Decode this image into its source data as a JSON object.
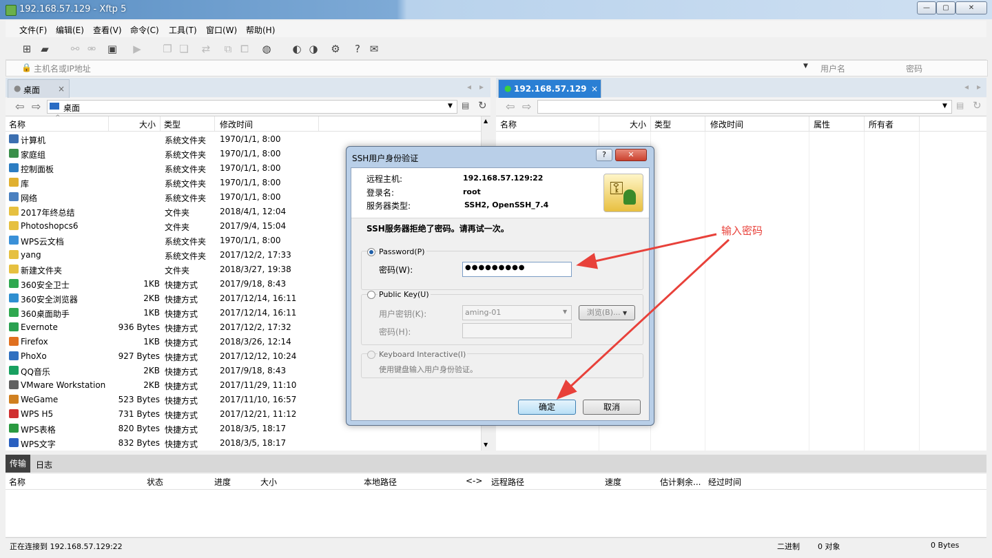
{
  "window": {
    "title": "192.168.57.129 - Xftp 5"
  },
  "menu": [
    "文件(F)",
    "编辑(E)",
    "查看(V)",
    "命令(C)",
    "工具(T)",
    "窗口(W)",
    "帮助(H)"
  ],
  "address": {
    "host_placeholder": "主机名或IP地址",
    "user_placeholder": "用户名",
    "pass_placeholder": "密码"
  },
  "left_pane": {
    "tab": "桌面",
    "path": "桌面",
    "columns": [
      "名称",
      "大小",
      "类型",
      "修改时间"
    ],
    "rows": [
      {
        "name": "计算机",
        "size": "",
        "type": "系统文件夹",
        "mtime": "1970/1/1, 8:00"
      },
      {
        "name": "家庭组",
        "size": "",
        "type": "系统文件夹",
        "mtime": "1970/1/1, 8:00"
      },
      {
        "name": "控制面板",
        "size": "",
        "type": "系统文件夹",
        "mtime": "1970/1/1, 8:00"
      },
      {
        "name": "库",
        "size": "",
        "type": "系统文件夹",
        "mtime": "1970/1/1, 8:00"
      },
      {
        "name": "网络",
        "size": "",
        "type": "系统文件夹",
        "mtime": "1970/1/1, 8:00"
      },
      {
        "name": "2017年终总结",
        "size": "",
        "type": "文件夹",
        "mtime": "2018/4/1, 12:04"
      },
      {
        "name": "Photoshopcs6",
        "size": "",
        "type": "文件夹",
        "mtime": "2017/9/4, 15:04"
      },
      {
        "name": "WPS云文档",
        "size": "",
        "type": "系统文件夹",
        "mtime": "1970/1/1, 8:00"
      },
      {
        "name": "yang",
        "size": "",
        "type": "系统文件夹",
        "mtime": "2017/12/2, 17:33"
      },
      {
        "name": "新建文件夹",
        "size": "",
        "type": "文件夹",
        "mtime": "2018/3/27, 19:38"
      },
      {
        "name": "360安全卫士",
        "size": "1KB",
        "type": "快捷方式",
        "mtime": "2017/9/18, 8:43"
      },
      {
        "name": "360安全浏览器",
        "size": "2KB",
        "type": "快捷方式",
        "mtime": "2017/12/14, 16:11"
      },
      {
        "name": "360桌面助手",
        "size": "1KB",
        "type": "快捷方式",
        "mtime": "2017/12/14, 16:11"
      },
      {
        "name": "Evernote",
        "size": "936 Bytes",
        "type": "快捷方式",
        "mtime": "2017/12/2, 17:32"
      },
      {
        "name": "Firefox",
        "size": "1KB",
        "type": "快捷方式",
        "mtime": "2018/3/26, 12:14"
      },
      {
        "name": "PhoXo",
        "size": "927 Bytes",
        "type": "快捷方式",
        "mtime": "2017/12/12, 10:24"
      },
      {
        "name": "QQ音乐",
        "size": "2KB",
        "type": "快捷方式",
        "mtime": "2017/9/18, 8:43"
      },
      {
        "name": "VMware Workstation",
        "size": "2KB",
        "type": "快捷方式",
        "mtime": "2017/11/29, 11:10"
      },
      {
        "name": "WeGame",
        "size": "523 Bytes",
        "type": "快捷方式",
        "mtime": "2017/11/10, 16:57"
      },
      {
        "name": "WPS H5",
        "size": "731 Bytes",
        "type": "快捷方式",
        "mtime": "2017/12/21, 11:12"
      },
      {
        "name": "WPS表格",
        "size": "820 Bytes",
        "type": "快捷方式",
        "mtime": "2018/3/5, 18:17"
      },
      {
        "name": "WPS文字",
        "size": "832 Bytes",
        "type": "快捷方式",
        "mtime": "2018/3/5, 18:17"
      }
    ]
  },
  "right_pane": {
    "tab": "192.168.57.129",
    "columns": [
      "名称",
      "大小",
      "类型",
      "修改时间",
      "属性",
      "所有者"
    ]
  },
  "bottom": {
    "tabs": [
      "传输",
      "日志"
    ],
    "columns": [
      "名称",
      "状态",
      "进度",
      "大小",
      "本地路径",
      "<->",
      "远程路径",
      "速度",
      "估计剩余...",
      "经过时间"
    ]
  },
  "status": {
    "left": "正在连接到 192.168.57.129:22",
    "mode": "二进制",
    "objects": "0 对象",
    "bytes": "0 Bytes"
  },
  "dialog": {
    "title": "SSH用户身份验证",
    "help": "?",
    "host_label": "远程主机:",
    "host_value": "192.168.57.129:22",
    "login_label": "登录名:",
    "login_value": "root",
    "server_label": "服务器类型:",
    "server_value": "SSH2, OpenSSH_7.4",
    "message": "SSH服务器拒绝了密码。请再试一次。",
    "password_option": "Password(P)",
    "password_label": "密码(W):",
    "password_value": "●●●●●●●●●",
    "pubkey_option": "Public Key(U)",
    "userkey_label": "用户密钥(K):",
    "userkey_value": "aming-01",
    "browse_label": "浏览(B)...",
    "passphrase_label": "密码(H):",
    "keyboard_option": "Keyboard Interactive(I)",
    "keyboard_desc": "使用键盘输入用户身份验证。",
    "ok_label": "确定",
    "cancel_label": "取消"
  },
  "annotation": {
    "text": "输入密码",
    "color": "#e8413a"
  }
}
